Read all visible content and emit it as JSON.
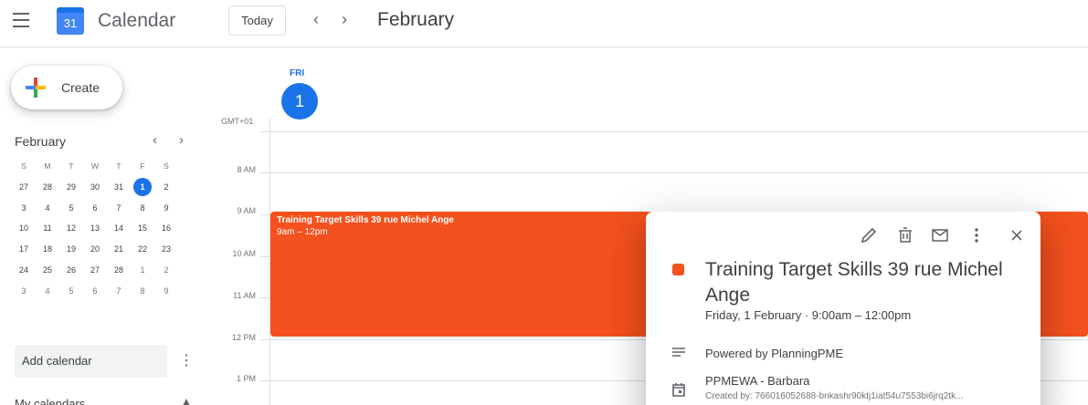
{
  "header": {
    "app_title": "Calendar",
    "logo_number": "31",
    "today_label": "Today",
    "prev_icon": "chevron-left",
    "next_icon": "chevron-right",
    "month": "February"
  },
  "sidebar": {
    "create_label": "Create",
    "mini": {
      "month": "February",
      "dow": [
        "S",
        "M",
        "T",
        "W",
        "T",
        "F",
        "S"
      ],
      "weeks": [
        [
          "27",
          "28",
          "29",
          "30",
          "31",
          "1",
          "2"
        ],
        [
          "3",
          "4",
          "5",
          "6",
          "7",
          "8",
          "9"
        ],
        [
          "10",
          "11",
          "12",
          "13",
          "14",
          "15",
          "16"
        ],
        [
          "17",
          "18",
          "19",
          "20",
          "21",
          "22",
          "23"
        ],
        [
          "24",
          "25",
          "26",
          "27",
          "28",
          "1",
          "2"
        ],
        [
          "3",
          "4",
          "5",
          "6",
          "7",
          "8",
          "9"
        ]
      ]
    },
    "add_calendar": "Add calendar",
    "my_calendars": "My calendars"
  },
  "day": {
    "dow": "FRI",
    "date": "1",
    "timezone": "GMT+01",
    "hours": [
      "8 AM",
      "9 AM",
      "10 AM",
      "11 AM",
      "12 PM",
      "1 PM"
    ]
  },
  "event": {
    "title": "Training Target Skills 39 rue Michel Ange",
    "time": "9am – 12pm",
    "color": "#f4511e"
  },
  "popup": {
    "title": "Training Target Skills 39 rue Michel Ange",
    "date_line": "Friday, 1 February  ·  9:00am – 12:00pm",
    "description": "Powered by PlanningPME",
    "calendar": "PPMEWA - Barbara",
    "created_by": "Created by: 766016052688-bnkashr90ktj1iat54u7553bi6jrq2tk..."
  }
}
